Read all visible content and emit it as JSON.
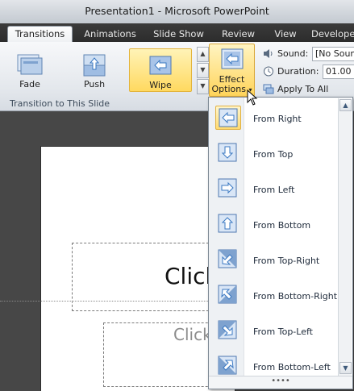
{
  "window": {
    "title": "Presentation1  -  Microsoft PowerPoint"
  },
  "tabs": [
    {
      "label": "Transitions",
      "active": true
    },
    {
      "label": "Animations"
    },
    {
      "label": "Slide Show"
    },
    {
      "label": "Review"
    },
    {
      "label": "View"
    },
    {
      "label": "Develope"
    }
  ],
  "gallery": {
    "items": [
      {
        "label": "Fade",
        "icon": "fade-thumbnail-icon"
      },
      {
        "label": "Push",
        "icon": "push-thumbnail-icon"
      },
      {
        "label": "Wipe",
        "icon": "wipe-thumbnail-icon",
        "selected": true
      }
    ],
    "group_label": "Transition to This Slide"
  },
  "effect_options": {
    "label_line1": "Effect",
    "label_line2": "Options",
    "arrow": "▾"
  },
  "timing": {
    "sound_label": "Sound:",
    "sound_value": "[No Sound]",
    "duration_label": "Duration:",
    "duration_value": "01.00",
    "apply_all_label": "Apply To All"
  },
  "slide": {
    "title_placeholder": "Click",
    "subtitle_placeholder": "Click"
  },
  "menu": {
    "items": [
      {
        "label": "From Right",
        "icon": "arrow-left-icon",
        "current": true
      },
      {
        "label": "From Top",
        "icon": "arrow-down-icon"
      },
      {
        "label": "From Left",
        "icon": "arrow-right-icon"
      },
      {
        "label": "From Bottom",
        "icon": "arrow-up-icon"
      },
      {
        "label": "From Top-Right",
        "icon": "arrow-down-left-icon"
      },
      {
        "label": "From Bottom-Right",
        "icon": "arrow-up-left-icon"
      },
      {
        "label": "From Top-Left",
        "icon": "arrow-down-right-icon"
      },
      {
        "label": "From Bottom-Left",
        "icon": "arrow-up-right-icon"
      }
    ],
    "resize_grip": "••••"
  },
  "colors": {
    "selected_fill": "#ffd960",
    "tab_bar": "#2c2c2c",
    "ribbon": "#e3e7ec",
    "icon_blue": "#3a78c2"
  }
}
